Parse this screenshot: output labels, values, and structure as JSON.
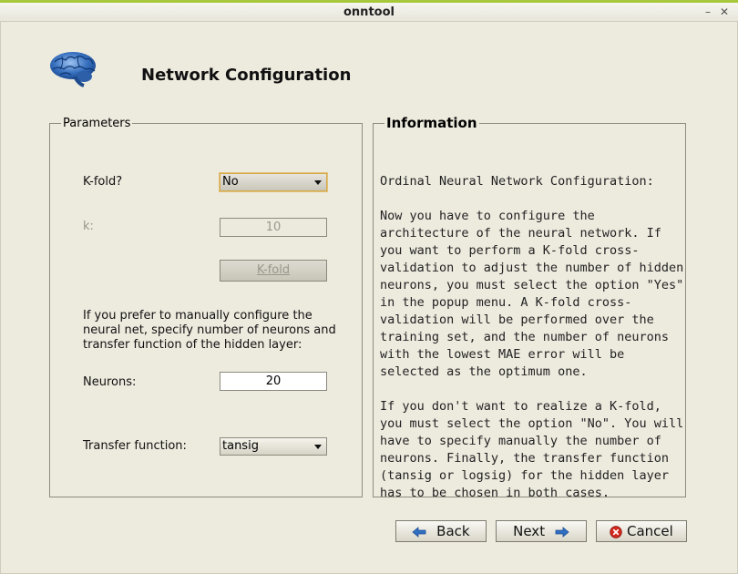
{
  "window": {
    "title": "onntool",
    "minimize": "–",
    "close": "✕"
  },
  "header": {
    "title": "Network Configuration",
    "icon": "brain-icon"
  },
  "parameters": {
    "legend": "Parameters",
    "kfold_label": "K-fold?",
    "kfold_value": "No",
    "k_label": "k:",
    "k_value": "10",
    "kfold_button": "K-fold",
    "description": "If you prefer to manually configure the neural net, specify number of neurons and transfer function of the hidden layer:",
    "neurons_label": "Neurons:",
    "neurons_value": "20",
    "transfer_label": "Transfer function:",
    "transfer_value": "tansig"
  },
  "information": {
    "legend": "Information",
    "text": "Ordinal Neural Network Configuration:\n\nNow you have to configure the architecture of the neural network. If you want to perform a K-fold cross-validation to adjust the number of hidden neurons, you must select the option \"Yes\" in the popup menu. A K-fold cross-validation will be performed over the training set, and the number of neurons with the lowest MAE error will be selected as the optimum one.\n\nIf you don't want to realize a K-fold, you must select the option \"No\". You will have to specify manually the number of neurons. Finally, the transfer function (tansig or logsig) for the hidden layer has to be chosen in both cases."
  },
  "footer": {
    "back_label": "Back",
    "next_label": "Next",
    "cancel_label": "Cancel"
  },
  "colors": {
    "background": "#edeade",
    "accent_bar": "#a8c83c",
    "arrow_blue": "#2f6fc2",
    "cancel_red": "#d2281e"
  }
}
